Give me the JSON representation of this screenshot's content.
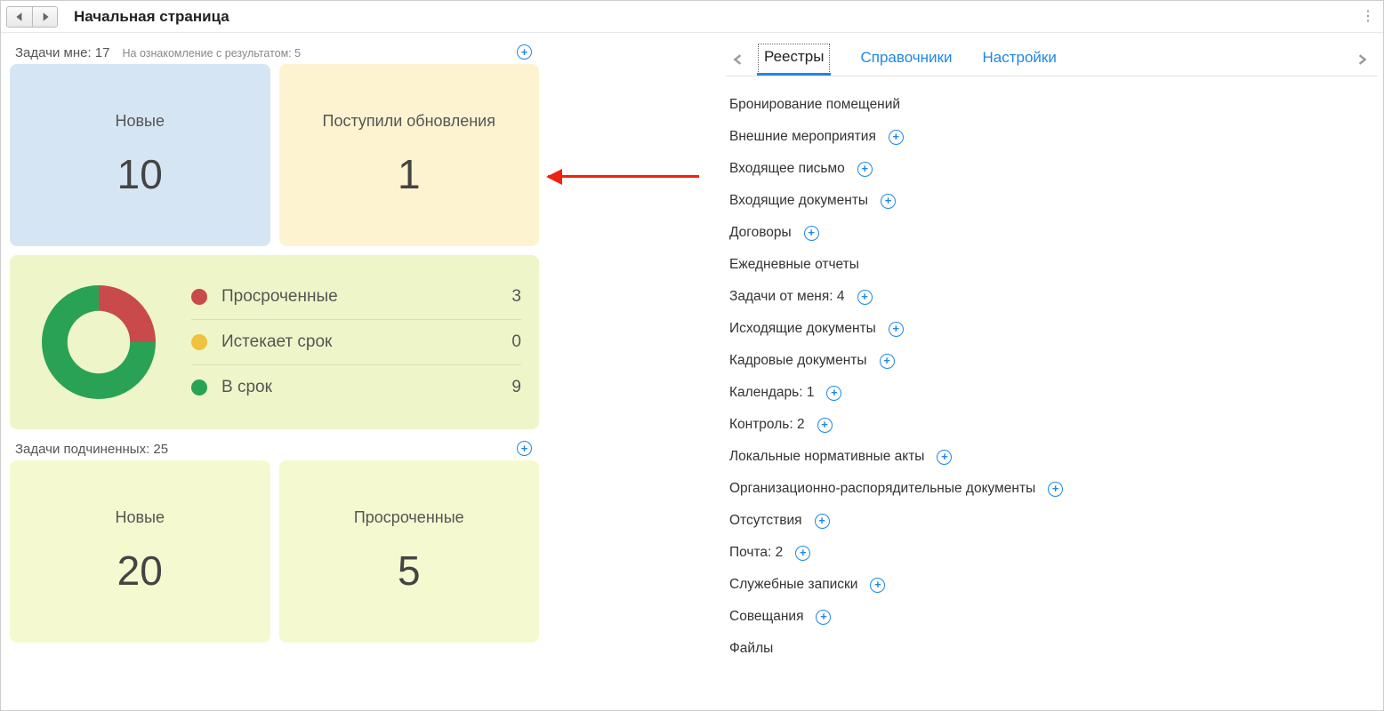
{
  "page_title": "Начальная страница",
  "my_tasks": {
    "title": "Задачи мне: 17",
    "subtitle": "На ознакомление с результатом: 5",
    "tile_new": {
      "label": "Новые",
      "value": "10"
    },
    "tile_updates": {
      "label": "Поступили обновления",
      "value": "1"
    }
  },
  "chart_data": {
    "type": "pie",
    "title": "",
    "series": [
      {
        "name": "Просроченные",
        "value": 3,
        "color": "#c94a4a"
      },
      {
        "name": "Истекает срок",
        "value": 0,
        "color": "#f0c23e"
      },
      {
        "name": "В срок",
        "value": 9,
        "color": "#2aa256"
      }
    ]
  },
  "sub_tasks": {
    "title": "Задачи подчиненных: 25",
    "tile_new": {
      "label": "Новые",
      "value": "20"
    },
    "tile_overdue": {
      "label": "Просроченные",
      "value": "5"
    }
  },
  "tabs": {
    "registries": "Реестры",
    "reference": "Справочники",
    "settings": "Настройки"
  },
  "registry": {
    "items": [
      {
        "label": "Бронирование помещений",
        "add": false
      },
      {
        "label": "Внешние мероприятия",
        "add": true
      },
      {
        "label": "Входящее письмо",
        "add": true
      },
      {
        "label": "Входящие документы",
        "add": true
      },
      {
        "label": "Договоры",
        "add": true
      },
      {
        "label": "Ежедневные отчеты",
        "add": false
      },
      {
        "label": "Задачи от меня: 4",
        "add": true
      },
      {
        "label": "Исходящие документы",
        "add": true
      },
      {
        "label": "Кадровые документы",
        "add": true
      },
      {
        "label": "Календарь: 1",
        "add": true
      },
      {
        "label": "Контроль: 2",
        "add": true
      },
      {
        "label": "Локальные нормативные акты",
        "add": true
      },
      {
        "label": "Организационно-распорядительные документы",
        "add": true
      },
      {
        "label": "Отсутствия",
        "add": true
      },
      {
        "label": "Почта: 2",
        "add": true
      },
      {
        "label": "Служебные записки",
        "add": true
      },
      {
        "label": "Совещания",
        "add": true
      },
      {
        "label": "Файлы",
        "add": false
      }
    ]
  }
}
